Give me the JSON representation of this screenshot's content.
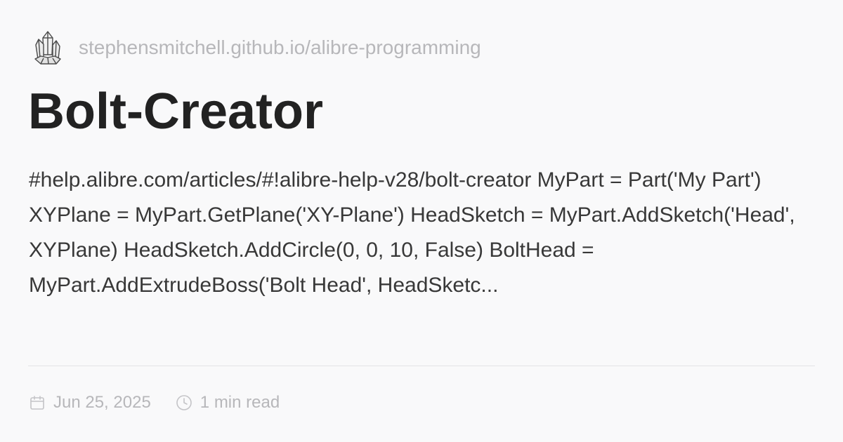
{
  "site": {
    "url": "stephensmitchell.github.io/alibre-programming",
    "logo_icon": "crystal-cluster-icon"
  },
  "post": {
    "title": "Bolt-Creator",
    "excerpt": "#help.alibre.com/articles/#!alibre-help-v28/bolt-creator MyPart = Part('My Part') XYPlane = MyPart.GetPlane('XY-Plane') HeadSketch = MyPart.AddSketch('Head', XYPlane) HeadSketch.AddCircle(0, 0, 10, False) BoltHead = MyPart.AddExtrudeBoss('Bolt Head', HeadSketc..."
  },
  "meta": {
    "date": "Jun 25, 2025",
    "date_icon": "calendar-icon",
    "read_time": "1 min read",
    "read_time_icon": "clock-icon"
  },
  "colors": {
    "background": "#f9f9fa",
    "title": "#222222",
    "body_text": "#383838",
    "muted": "#b7b7ba",
    "divider": "#e4e4e6"
  }
}
